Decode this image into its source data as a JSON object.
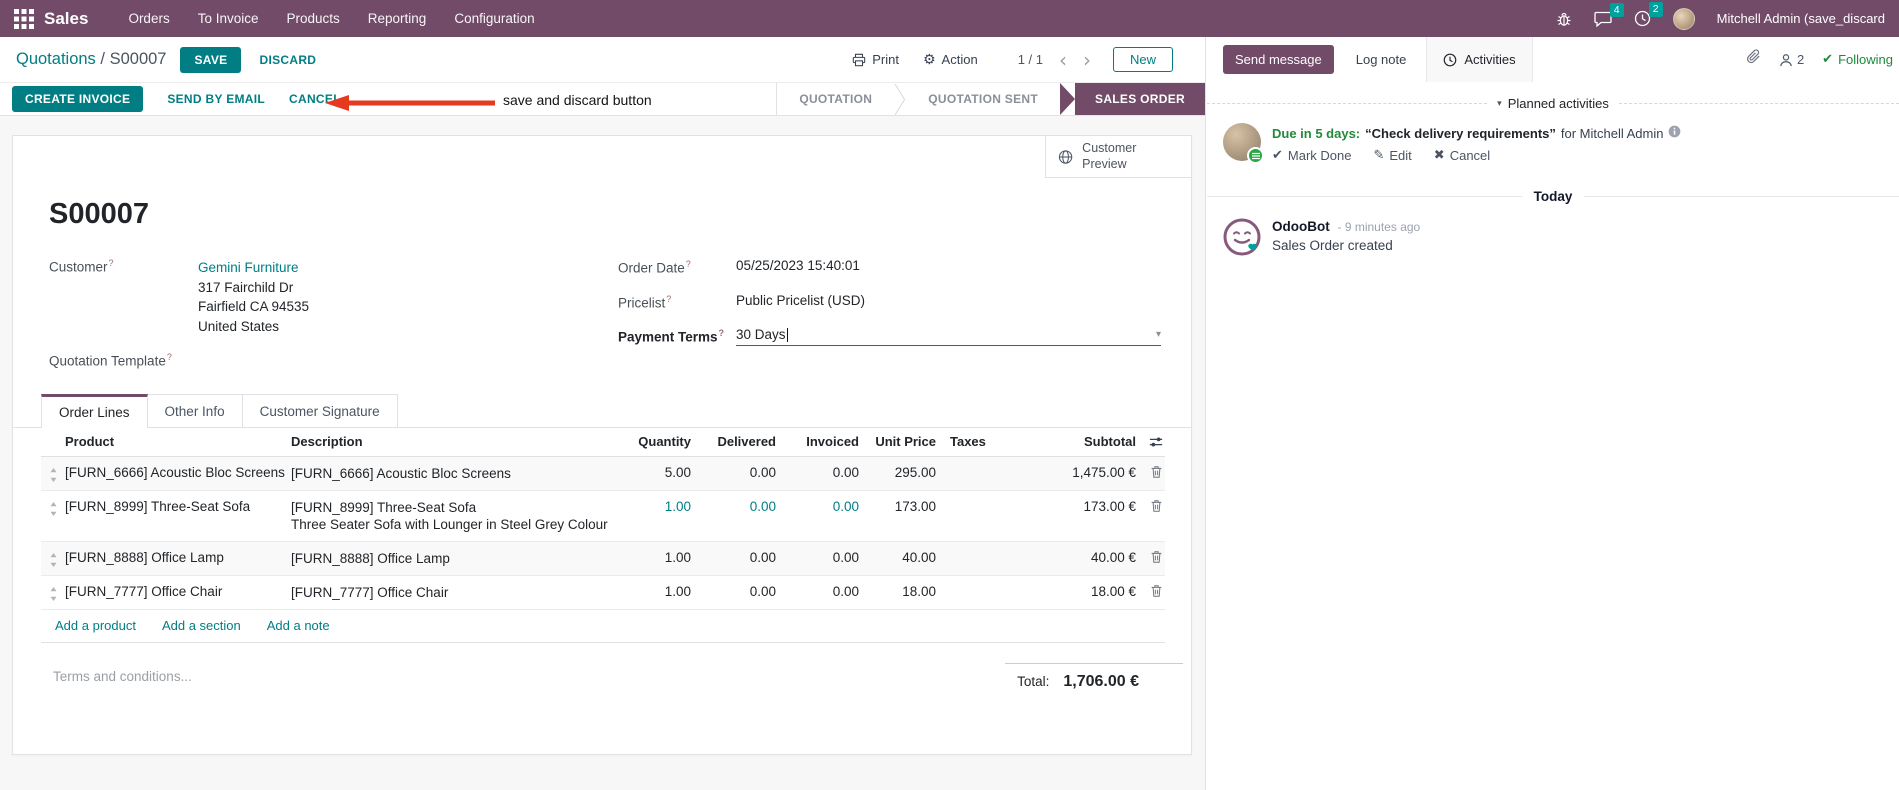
{
  "navbar": {
    "app_name": "Sales",
    "menus": [
      "Orders",
      "To Invoice",
      "Products",
      "Reporting",
      "Configuration"
    ],
    "messages_badge": "4",
    "activities_badge": "2",
    "user_name": "Mitchell Admin (save_discard"
  },
  "control_panel": {
    "breadcrumb_parent": "Quotations",
    "breadcrumb_separator": "/",
    "breadcrumb_current": "S00007",
    "save": "SAVE",
    "discard": "DISCARD",
    "annotation": "save and discard button",
    "print": "Print",
    "action": "Action",
    "pager": "1 / 1",
    "prev": "‹",
    "next": "›",
    "new": "New"
  },
  "status_buttons": {
    "create_invoice": "CREATE INVOICE",
    "send_by_email": "SEND BY EMAIL",
    "cancel": "CANCEL"
  },
  "statusbar_steps": [
    {
      "label": "QUOTATION"
    },
    {
      "label": "QUOTATION SENT"
    },
    {
      "label": "SALES ORDER"
    }
  ],
  "sheet": {
    "customer_preview": "Customer Preview",
    "title": "S00007",
    "help_marker": "?",
    "customer_label": "Customer",
    "customer_name": "Gemini Furniture",
    "customer_address": [
      "317 Fairchild Dr",
      "Fairfield CA 94535",
      "United States"
    ],
    "quotation_template_label": "Quotation Template",
    "order_date_label": "Order Date",
    "order_date": "05/25/2023 15:40:01",
    "pricelist_label": "Pricelist",
    "pricelist": "Public Pricelist (USD)",
    "payment_terms_label": "Payment Terms",
    "payment_terms": "30 Days",
    "dropdown_caret": "▾",
    "tabs": [
      "Order Lines",
      "Other Info",
      "Customer Signature"
    ]
  },
  "order_lines": {
    "columns": {
      "product": "Product",
      "description": "Description",
      "quantity": "Quantity",
      "delivered": "Delivered",
      "invoiced": "Invoiced",
      "unit_price": "Unit Price",
      "taxes": "Taxes",
      "subtotal": "Subtotal"
    },
    "rows": [
      {
        "product": "[FURN_6666] Acoustic Bloc Screens",
        "description": "[FURN_6666] Acoustic Bloc Screens",
        "quantity": "5.00",
        "delivered": "0.00",
        "invoiced": "0.00",
        "unit_price": "295.00",
        "subtotal": "1,475.00 €"
      },
      {
        "product": "[FURN_8999] Three-Seat Sofa",
        "description": "[FURN_8999] Three-Seat Sofa",
        "description2": "Three Seater Sofa with Lounger in Steel Grey Colour",
        "quantity": "1.00",
        "delivered": "0.00",
        "invoiced": "0.00",
        "unit_price": "173.00",
        "subtotal": "173.00 €"
      },
      {
        "product": "[FURN_8888] Office Lamp",
        "description": "[FURN_8888] Office Lamp",
        "quantity": "1.00",
        "delivered": "0.00",
        "invoiced": "0.00",
        "unit_price": "40.00",
        "subtotal": "40.00 €"
      },
      {
        "product": "[FURN_7777] Office Chair",
        "description": "[FURN_7777] Office Chair",
        "quantity": "1.00",
        "delivered": "0.00",
        "invoiced": "0.00",
        "unit_price": "18.00",
        "subtotal": "18.00 €"
      }
    ],
    "add_links": [
      "Add a product",
      "Add a section",
      "Add a note"
    ],
    "terms_placeholder": "Terms and conditions...",
    "total_label": "Total:",
    "total_value": "1,706.00 €"
  },
  "chatter": {
    "send_message": "Send message",
    "log_note": "Log note",
    "activities_tab": "Activities",
    "followers_count": "2",
    "following": "Following",
    "planned_activities": "Planned activities",
    "planned_caret": "▾",
    "activity": {
      "due": "Due in 5 days:",
      "summary": "“Check delivery requirements”",
      "assignee": "for Mitchell Admin",
      "mark_done": "Mark Done",
      "edit": "Edit",
      "cancel": "Cancel",
      "mark_done_glyph": "✔",
      "edit_glyph": "✎",
      "cancel_glyph": "✖"
    },
    "today": "Today",
    "message": {
      "author": "OdooBot",
      "time": "- 9 minutes ago",
      "body": "Sales Order created"
    }
  },
  "colors": {
    "brand_purple": "#714B67",
    "primary_teal": "#017E84",
    "badge_teal": "#00A09D",
    "success_green": "#28a745",
    "annotation_red": "#e63a1e"
  }
}
